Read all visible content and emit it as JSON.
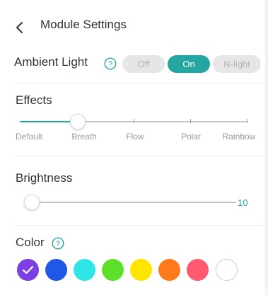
{
  "header": {
    "title": "Module Settings",
    "back_icon": "chevron-left-icon"
  },
  "ambient_light": {
    "label": "Ambient Light",
    "options": [
      "Off",
      "On",
      "N-light"
    ],
    "selected": "On"
  },
  "effects": {
    "title": "Effects",
    "options": [
      "Default",
      "Breath",
      "Flow",
      "Polar",
      "Rainbow"
    ],
    "selected": "Breath"
  },
  "brightness": {
    "title": "Brightness",
    "value": "10",
    "level_fraction": 0.0
  },
  "color": {
    "title": "Color",
    "swatches": [
      "#7b3fe4",
      "#1f57e6",
      "#2ee6e6",
      "#5ee02a",
      "#ffe400",
      "#ff7a1a",
      "#ff5a72",
      "#ffffff"
    ],
    "selected_index": 0
  },
  "colors": {
    "accent": "#26a6a0",
    "inactive": "#e6e6e6"
  }
}
